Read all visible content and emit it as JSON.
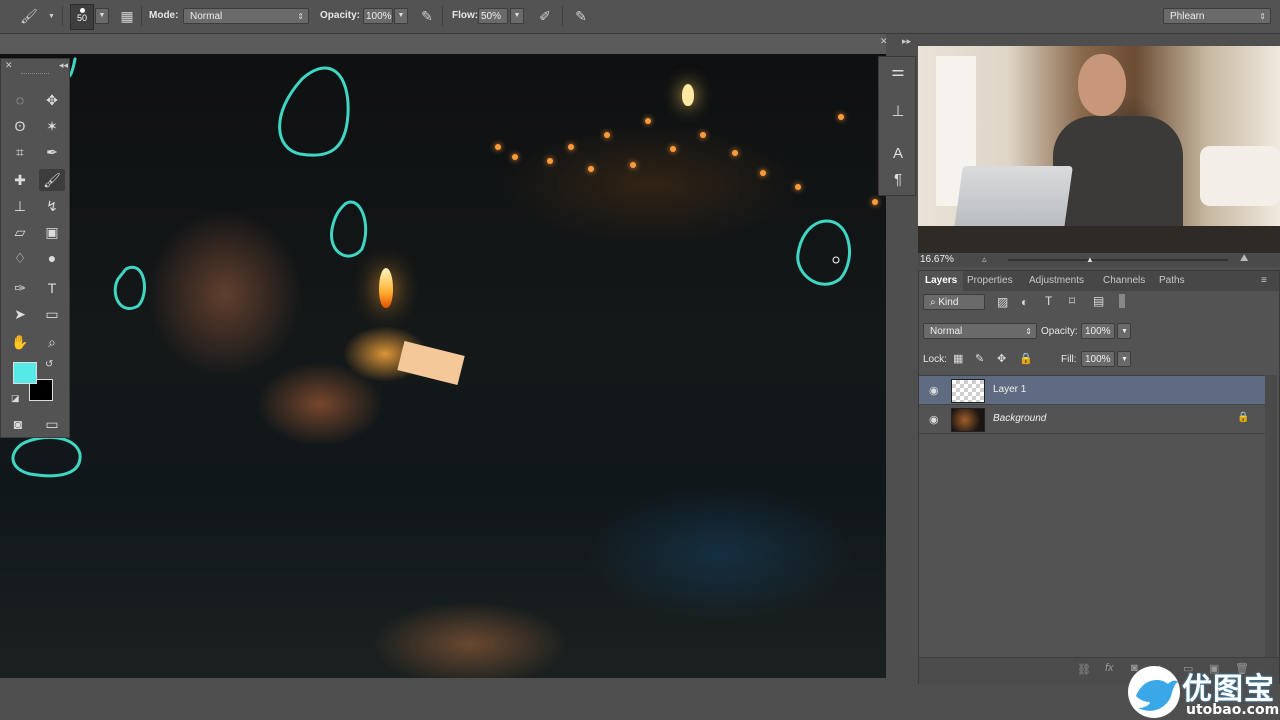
{
  "options_bar": {
    "brush_size": "50",
    "mode_label": "Mode:",
    "mode_value": "Normal",
    "opacity_label": "Opacity:",
    "opacity_value": "100%",
    "flow_label": "Flow:",
    "flow_value": "50%",
    "workspace": "Phlearn"
  },
  "tools": {
    "foreground_color": "#57e8e8",
    "background_color": "#000000"
  },
  "video": {
    "zoom": "16.67%"
  },
  "layers_panel": {
    "tabs": [
      "Layers",
      "Properties",
      "Adjustments",
      "Channels",
      "Paths"
    ],
    "filter_kind": "Kind",
    "blend_mode": "Normal",
    "opacity_label": "Opacity:",
    "opacity_value": "100%",
    "lock_label": "Lock:",
    "fill_label": "Fill:",
    "fill_value": "100%",
    "layers": [
      {
        "name": "Layer 1"
      },
      {
        "name": "Background"
      }
    ]
  },
  "watermark": {
    "cn": "优图宝",
    "url": "utobao.com"
  }
}
